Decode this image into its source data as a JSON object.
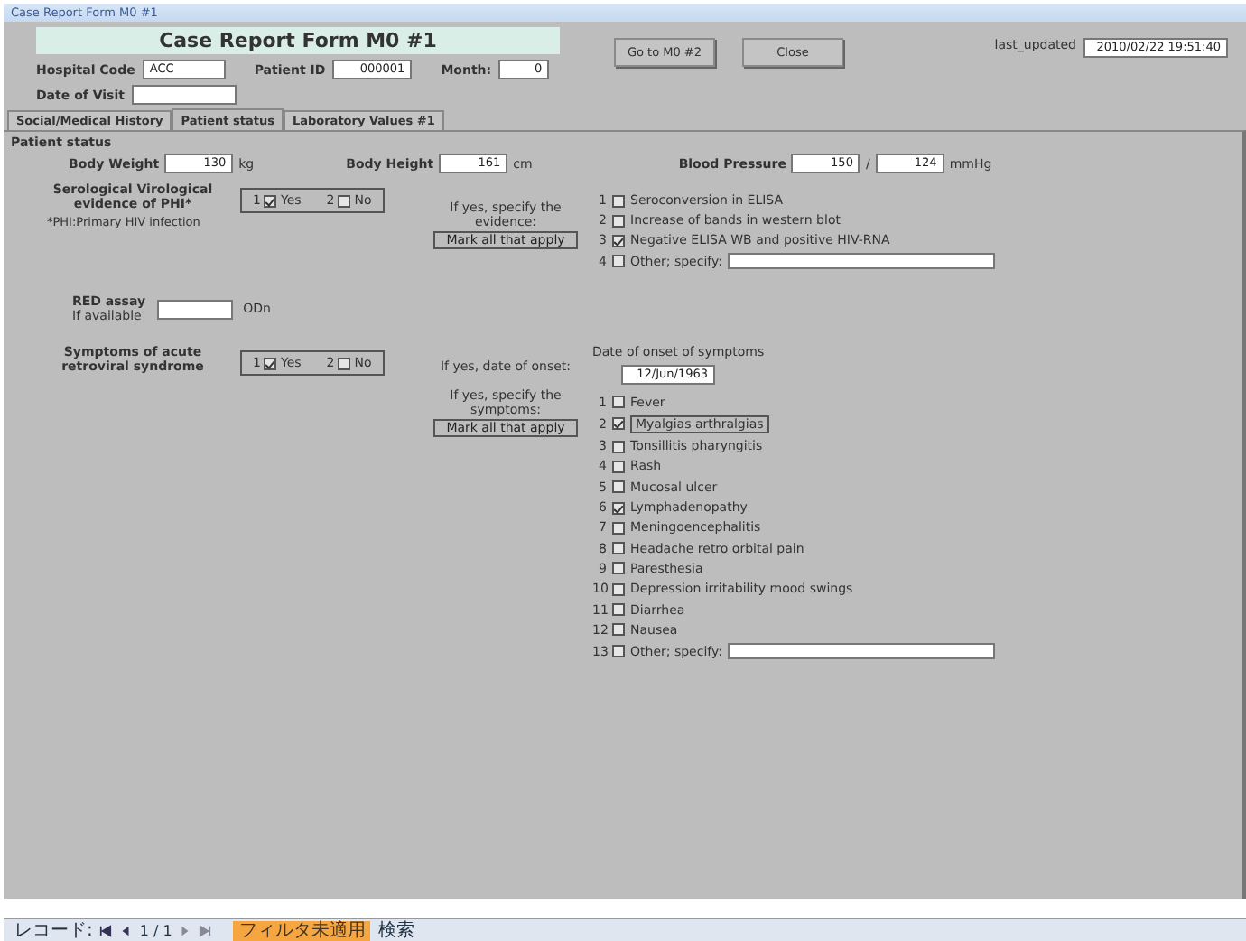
{
  "window": {
    "title": "Case Report Form M0 #1"
  },
  "header": {
    "title": "Case Report Form M0 #1",
    "fields": [
      {
        "label": "Hospital Code",
        "value": "ACC"
      },
      {
        "label": "Patient ID",
        "value": "000001"
      },
      {
        "label": "Month:",
        "value": "0"
      }
    ],
    "date_of_visit": {
      "label": "Date of Visit"
    },
    "buttons": [
      "Go to M0 #2",
      "Close"
    ],
    "last_updated": {
      "label": "last_updated",
      "value": "2010/02/22 19:51:40"
    }
  },
  "tabs": [
    {
      "label": "Social/Medical History",
      "selected": false
    },
    {
      "label": "Patient status",
      "selected": true
    },
    {
      "label": "Laboratory Values #1",
      "selected": false
    }
  ],
  "panel": {
    "heading": "Patient status",
    "measures": [
      {
        "label": "Body Weight",
        "value": "130",
        "unit": "kg"
      },
      {
        "label": "Body Height",
        "value": "161",
        "unit": "cm"
      }
    ],
    "blood_pressure": {
      "label": "Blood Pressure",
      "systolic": "150",
      "separator": "/",
      "diastolic": "124",
      "unit": "mmHg"
    },
    "evidence": {
      "label": "Serological Virological evidence of PHI*",
      "note": "*PHI:Primary HIV infection",
      "options": [
        {
          "number": "1",
          "label": "Yes",
          "checked": true
        },
        {
          "number": "2",
          "label": "No",
          "checked": false
        }
      ],
      "specify": "If yes, specify the evidence:",
      "mark": "Mark all that apply",
      "items": [
        {
          "kind": "plain",
          "number": "1",
          "label": "Seroconversion in ELISA",
          "checked": false
        },
        {
          "kind": "plain",
          "number": "2",
          "label": "Increase of bands in western blot",
          "checked": false
        },
        {
          "kind": "plain",
          "number": "3",
          "label": "Negative ELISA WB and positive HIV-RNA",
          "checked": true
        },
        {
          "kind": "other",
          "number": "4",
          "label": "Other; specify:",
          "checked": false
        }
      ]
    },
    "red_assay": {
      "label": "RED assay",
      "sublabel": "If available",
      "unit": "ODn"
    },
    "symptoms": {
      "label": "Symptoms of acute retroviral syndrome",
      "options": [
        {
          "number": "1",
          "label": "Yes",
          "checked": true
        },
        {
          "number": "2",
          "label": "No",
          "checked": false
        }
      ],
      "onset_prompt": "If yes, date of onset:",
      "onset_label": "Date of onset of symptoms",
      "onset_value": "12/Jun/1963",
      "specify": "If yes, specify the symptoms:",
      "mark": "Mark all that apply",
      "items": [
        {
          "kind": "plain",
          "number": "1",
          "label": "Fever",
          "checked": false
        },
        {
          "kind": "plain",
          "number": "2",
          "label": "Myalgias arthralgias",
          "checked": true
        },
        {
          "kind": "plain",
          "number": "3",
          "label": "Tonsillitis pharyngitis",
          "checked": false
        },
        {
          "kind": "plain",
          "number": "4",
          "label": "Rash",
          "checked": false
        },
        {
          "kind": "plain",
          "number": "5",
          "label": "Mucosal ulcer",
          "checked": false
        },
        {
          "kind": "plain",
          "number": "6",
          "label": "Lymphadenopathy",
          "checked": true
        },
        {
          "kind": "plain",
          "number": "7",
          "label": "Meningoencephalitis",
          "checked": false
        },
        {
          "kind": "plain",
          "number": "8",
          "label": "Headache retro orbital pain",
          "checked": false
        },
        {
          "kind": "plain",
          "number": "9",
          "label": "Paresthesia",
          "checked": false
        },
        {
          "kind": "plain",
          "number": "10",
          "label": "Depression irritability mood swings",
          "checked": false
        },
        {
          "kind": "plain",
          "number": "11",
          "label": "Diarrhea",
          "checked": false
        },
        {
          "kind": "plain",
          "number": "12",
          "label": "Nausea",
          "checked": false
        },
        {
          "kind": "other",
          "number": "13",
          "label": "Other; specify:",
          "checked": false
        }
      ]
    }
  },
  "status_bar": {
    "label": "レコード:",
    "position": "1 / 1",
    "filter": "フィルタ未適用",
    "search": "検索"
  }
}
